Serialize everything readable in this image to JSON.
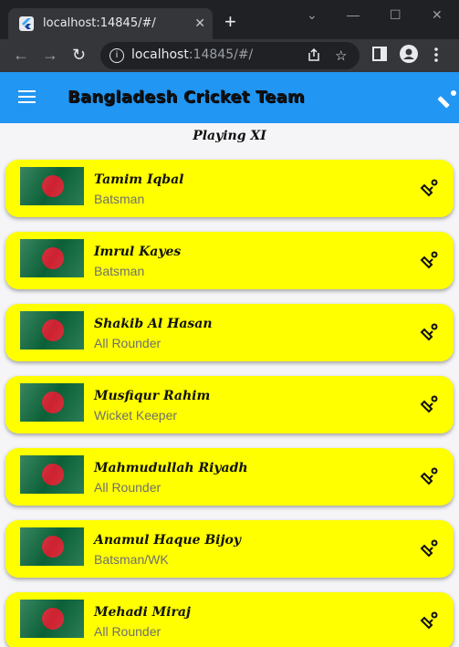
{
  "browser": {
    "tab_title": "localhost:14845/#/",
    "tab_close": "✕",
    "new_tab": "+",
    "url_host": "localhost",
    "url_rest": ":14845/#/",
    "minimize": "—",
    "maximize": "☐",
    "close": "✕",
    "back": "←",
    "forward": "→",
    "reload": "↻"
  },
  "app": {
    "title": "Bangladesh Cricket Team",
    "subtitle": "Playing XI"
  },
  "players": [
    {
      "name": "Tamim Iqbal",
      "role": "Batsman"
    },
    {
      "name": "Imrul Kayes",
      "role": "Batsman"
    },
    {
      "name": "Shakib Al Hasan",
      "role": "All Rounder"
    },
    {
      "name": "Musfiqur Rahim",
      "role": "Wicket Keeper"
    },
    {
      "name": "Mahmudullah Riyadh",
      "role": "All Rounder"
    },
    {
      "name": "Anamul Haque Bijoy",
      "role": "Batsman/WK"
    },
    {
      "name": "Mehadi Miraj",
      "role": "All Rounder"
    }
  ],
  "colors": {
    "appbar": "#2196f3",
    "card": "#ffff00",
    "flag_green": "#0d6b3e",
    "flag_red": "#e32636"
  },
  "icons": {
    "player_action": "cricket-bat-ball-icon",
    "appbar_action": "cricket-bat-ball-icon",
    "menu": "hamburger-menu-icon"
  }
}
